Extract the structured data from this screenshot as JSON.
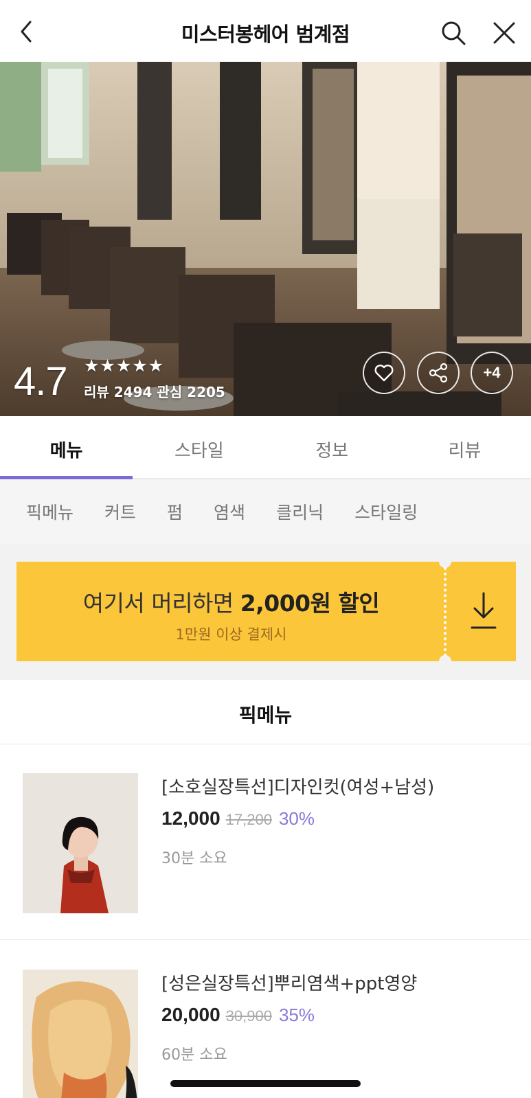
{
  "header": {
    "title": "미스터봉헤어 범계점",
    "back_icon": "chevron-left-icon",
    "search_icon": "search-icon",
    "close_icon": "close-icon"
  },
  "hero": {
    "rating": "4.7",
    "stars": "★★★★★",
    "counts": "리뷰 2494 관심 2205",
    "more_label": "+4"
  },
  "tabs": [
    {
      "label": "메뉴",
      "active": true
    },
    {
      "label": "스타일",
      "active": false
    },
    {
      "label": "정보",
      "active": false
    },
    {
      "label": "리뷰",
      "active": false
    }
  ],
  "subcategories": [
    "픽메뉴",
    "커트",
    "펌",
    "염색",
    "클리닉",
    "스타일링"
  ],
  "coupon": {
    "headline_prefix": "여기서 머리하면 ",
    "headline_amount": "2,000원 할인",
    "condition": "1만원 이상 결제시",
    "accent": "#fcc63a"
  },
  "section": {
    "title": "픽메뉴"
  },
  "items": [
    {
      "name": "[소호실장특선]디자인컷(여성+남성)",
      "price": "12,000",
      "original": "17,200",
      "discount": "30%",
      "duration": "30분 소요"
    },
    {
      "name": "[성은실장특선]뿌리염색+ppt영양",
      "price": "20,000",
      "original": "30,900",
      "discount": "35%",
      "duration": "60분 소요"
    }
  ],
  "colors": {
    "accent": "#7a6ad8",
    "discount": "#8b7ad6"
  }
}
